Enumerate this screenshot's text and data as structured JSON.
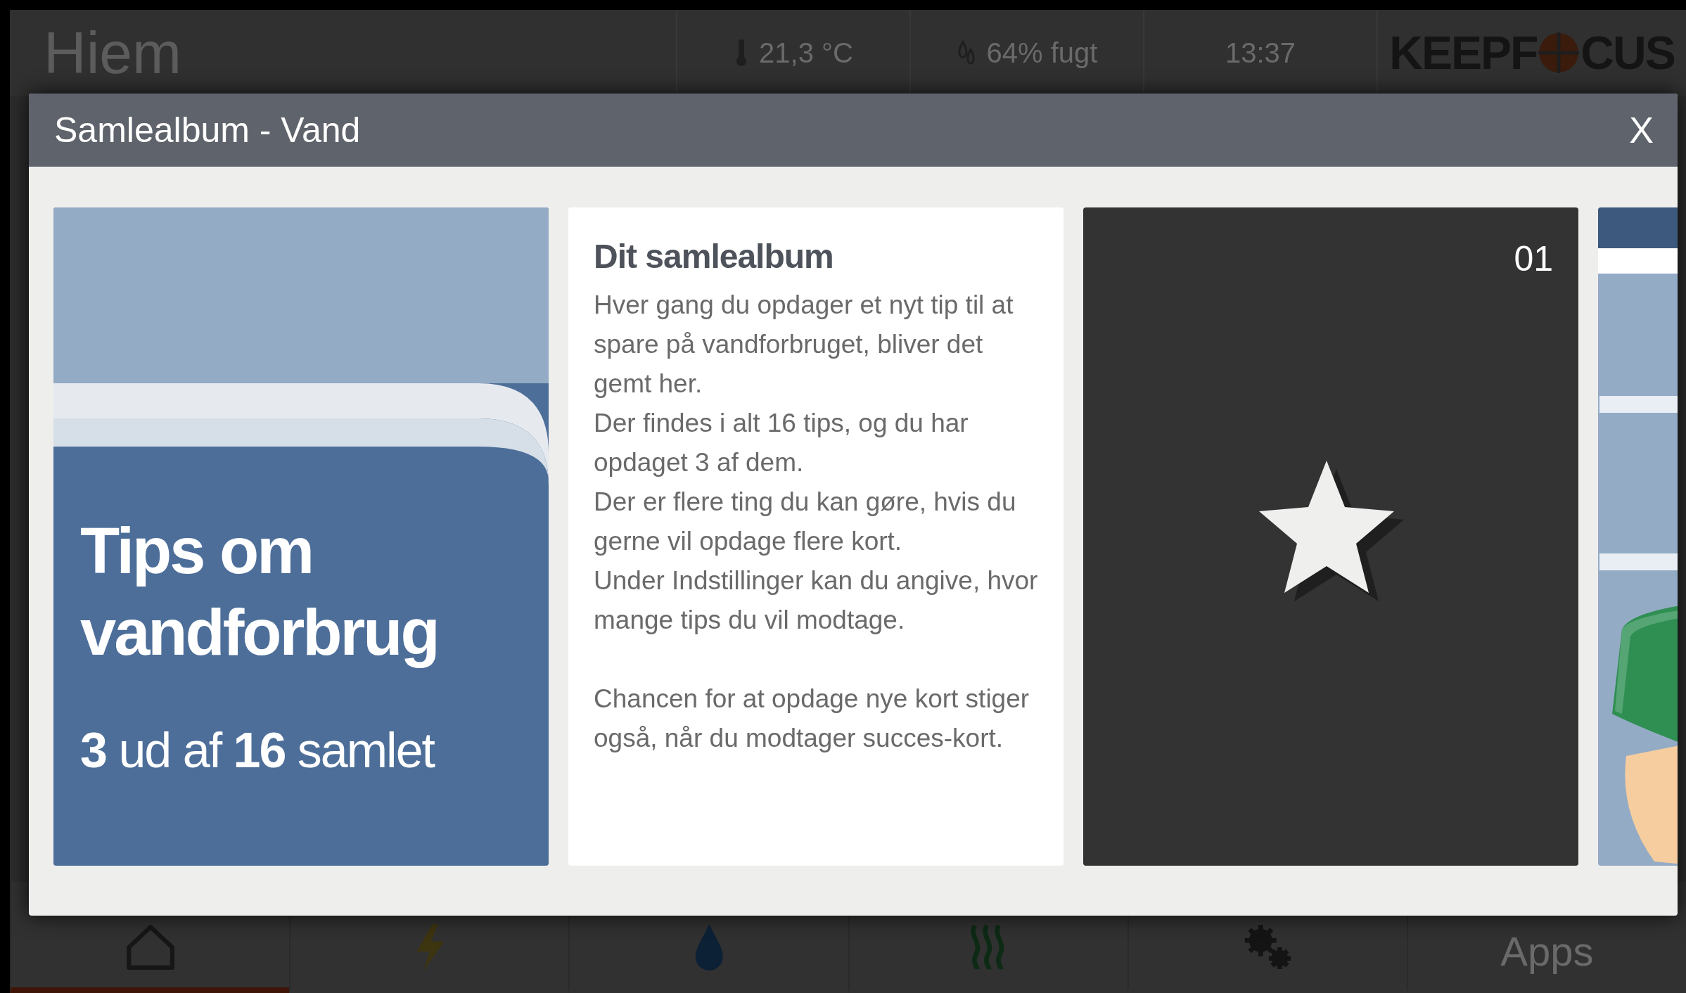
{
  "background_app": {
    "header": {
      "title": "Hiem",
      "temperature": "21,3 °C",
      "humidity": "64% fugt",
      "time": "13:37",
      "logo": {
        "text_before": "KEEPF",
        "text_after": "CUS"
      }
    },
    "nav": [
      {
        "kind": "home",
        "selected": true
      },
      {
        "kind": "power",
        "selected": false
      },
      {
        "kind": "water",
        "selected": false
      },
      {
        "kind": "heat",
        "selected": false
      },
      {
        "kind": "settings",
        "selected": false
      },
      {
        "kind": "text",
        "label": "Apps",
        "selected": false
      }
    ]
  },
  "dialog": {
    "title": "Samlealbum - Vand",
    "close": "X",
    "cards": [
      {
        "kind": "summary",
        "title": "Tips om vandforbrug",
        "count": "**3** ud af **16** samlet"
      },
      {
        "kind": "info",
        "title": "Dit samlealbum",
        "sections": [
          {
            "lines": [
              "Hver gang du opdager et nyt tip til at spare på vandforbruget, bliver det gemt her.",
              "Der findes i alt 16 tips, og du har opdaget 3 af dem.",
              "Der er flere ting du kan gøre, hvis du gerne vil opdage flere kort.",
              "Under Indstillinger kan du angive, hvor mange tips du vil modtage."
            ]
          },
          {
            "lines": [
              "Chancen for at opdage nye kort stiger også, når du modtager succes-kort."
            ]
          }
        ]
      },
      {
        "kind": "tip",
        "number": "01"
      },
      {
        "kind": "picture"
      }
    ]
  }
}
